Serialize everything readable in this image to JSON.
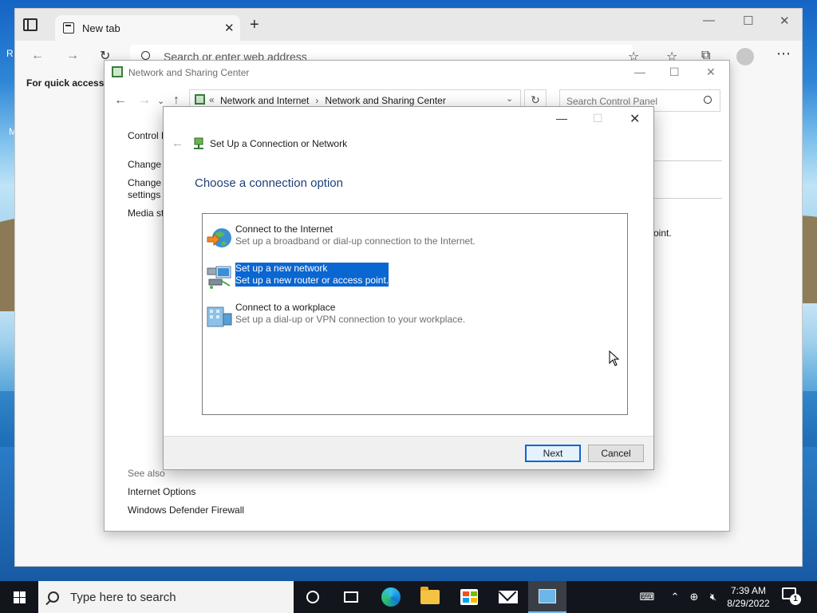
{
  "browser": {
    "tab_title": "New tab",
    "address_placeholder": "Search or enter web address",
    "quick_access_text": "For quick access, p"
  },
  "nsc_window": {
    "title": "Network and Sharing Center",
    "breadcrumb": [
      "Network and Internet",
      "Network and Sharing Center"
    ],
    "search_placeholder": "Search Control Panel",
    "sidebar": {
      "control_panel_home": "Control P",
      "change_adapter": "Change a",
      "change_advanced_line1": "Change a",
      "change_advanced_line2": "settings",
      "media_streaming": "Media st"
    },
    "partial_text": "oint.",
    "see_also": "See also",
    "links": [
      "Internet Options",
      "Windows Defender Firewall"
    ]
  },
  "dialog": {
    "title": "Set Up a Connection or Network",
    "heading": "Choose a connection option",
    "options": [
      {
        "title": "Connect to the Internet",
        "description": "Set up a broadband or dial-up connection to the Internet.",
        "icon": "globe-internet-icon",
        "selected": false
      },
      {
        "title": "Set up a new network",
        "description": "Set up a new router or access point.",
        "icon": "router-network-icon",
        "selected": true
      },
      {
        "title": "Connect to a workplace",
        "description": "Set up a dial-up or VPN connection to your workplace.",
        "icon": "workplace-building-icon",
        "selected": false
      }
    ],
    "next_label": "Next",
    "cancel_label": "Cancel"
  },
  "taskbar": {
    "search_placeholder": "Type here to search",
    "time": "7:39 AM",
    "date": "8/29/2022",
    "notification_count": "1"
  },
  "desktop": {
    "icon_fragment_1": "R",
    "icon_fragment_2": "M"
  },
  "colors": {
    "selection": "#0a66d0",
    "heading_blue": "#1e3f77",
    "taskbar": "#12161c"
  }
}
